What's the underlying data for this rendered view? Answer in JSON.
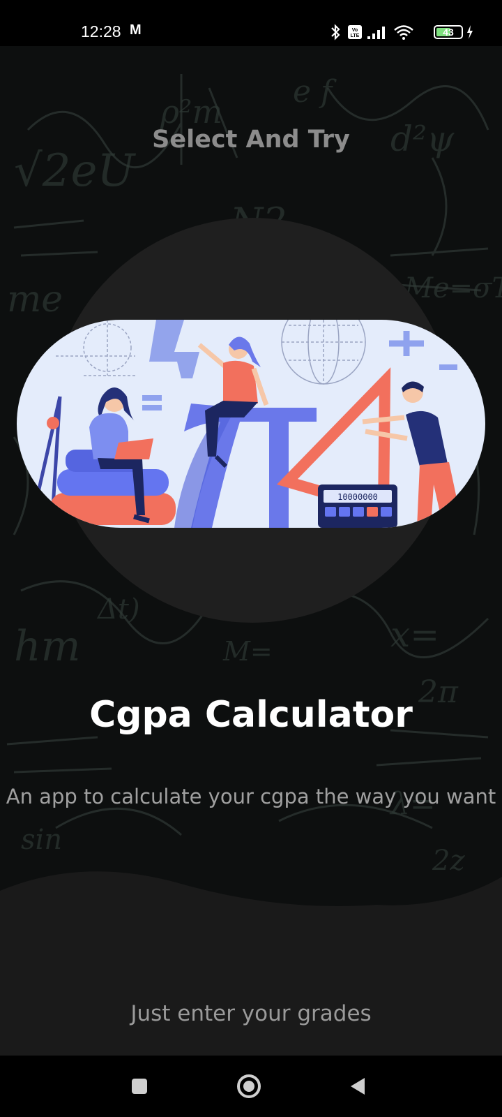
{
  "status_bar": {
    "time": "12:28",
    "carrier_icon_text": "M",
    "battery_level": "43",
    "icons": [
      "bluetooth-icon",
      "volte-icon",
      "signal-icon",
      "wifi-icon",
      "battery-icon",
      "charging-icon"
    ]
  },
  "onboarding": {
    "header": "Select And Try",
    "title": "Cgpa Calculator",
    "subtitle": "An app to calculate your cgpa the way you want",
    "hint": "Just enter your grades",
    "illustration": {
      "calculator_display": "10000000"
    }
  },
  "nav_bar": {
    "icons": [
      "recents-icon",
      "home-icon",
      "back-icon"
    ]
  },
  "colors": {
    "background": "#0d0f0f",
    "circle": "#1f1f1f",
    "illustration_bg": "#e4ecfb",
    "accent_red": "#f2705d",
    "accent_blue": "#6475f0"
  }
}
